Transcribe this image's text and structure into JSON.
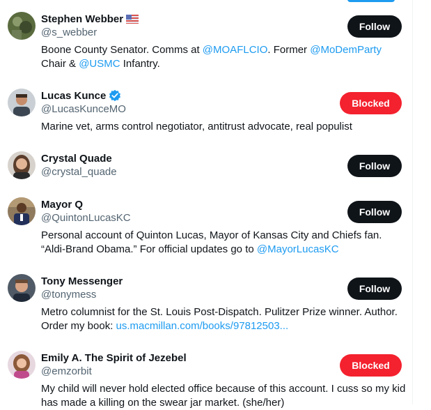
{
  "users": [
    {
      "name": "Stephen Webber",
      "handle": "@s_webber",
      "badge": "us-flag-icon",
      "button": "Follow",
      "bio": [
        {
          "t": "Boone County Senator. Comms at ",
          "link": false
        },
        {
          "t": "@MOAFLCIO",
          "link": true
        },
        {
          "t": ". Former ",
          "link": false
        },
        {
          "t": "@MoDemParty",
          "link": true
        },
        {
          "t": " Chair & ",
          "link": false
        },
        {
          "t": "@USMC",
          "link": true
        },
        {
          "t": " Infantry.",
          "link": false
        }
      ]
    },
    {
      "name": "Lucas Kunce",
      "handle": "@LucasKunceMO",
      "badge": "verified-badge-icon",
      "button": "Blocked",
      "bio": [
        {
          "t": "Marine vet, arms control negotiator, antitrust advocate, real populist",
          "link": false
        }
      ]
    },
    {
      "name": "Crystal Quade",
      "handle": "@crystal_quade",
      "badge": "",
      "button": "Follow",
      "bio": []
    },
    {
      "name": "Mayor Q",
      "handle": "@QuintonLucasKC",
      "badge": "",
      "button": "Follow",
      "bio": [
        {
          "t": "Personal account of Quinton Lucas, Mayor of Kansas City and Chiefs fan. “Aldi-Brand Obama.” For official updates go to ",
          "link": false
        },
        {
          "t": "@MayorLucasKC",
          "link": true
        }
      ]
    },
    {
      "name": "Tony Messenger",
      "handle": "@tonymess",
      "badge": "",
      "button": "Follow",
      "bio": [
        {
          "t": "Metro columnist for the St. Louis Post-Dispatch. Pulitzer Prize winner. Author. Order my book: ",
          "link": false
        },
        {
          "t": "us.macmillan.com/books/97812503...",
          "link": true
        }
      ]
    },
    {
      "name": "Emily A. The Spirit of Jezebel",
      "handle": "@emzorbit",
      "badge": "",
      "button": "Blocked",
      "bio": [
        {
          "t": "My child will never hold elected office because of this account. I cuss so my kid has made a killing on the swear jar market. (she/her)",
          "link": false
        }
      ]
    }
  ],
  "colors": {
    "follow_bg": "#0f1419",
    "blocked_bg": "#f4212e",
    "link": "#1d9bf0",
    "handle": "#536471"
  }
}
